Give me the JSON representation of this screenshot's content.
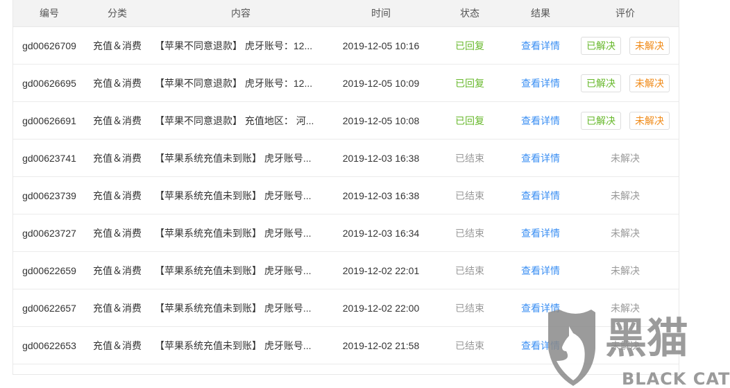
{
  "headers": [
    "编号",
    "分类",
    "内容",
    "时间",
    "状态",
    "结果",
    "评价"
  ],
  "rows": [
    {
      "id": "gd00626709",
      "cat": "充值＆消费",
      "content": "【苹果不同意退款】 虎牙账号：12...",
      "time": "2019-12-05 10:16",
      "status": "已回复",
      "result": "查看详情",
      "rated": false
    },
    {
      "id": "gd00626695",
      "cat": "充值＆消费",
      "content": "【苹果不同意退款】 虎牙账号：12...",
      "time": "2019-12-05 10:09",
      "status": "已回复",
      "result": "查看详情",
      "rated": false
    },
    {
      "id": "gd00626691",
      "cat": "充值＆消费",
      "content": "【苹果不同意退款】 充值地区： 河...",
      "time": "2019-12-05 10:08",
      "status": "已回复",
      "result": "查看详情",
      "rated": false
    },
    {
      "id": "gd00623741",
      "cat": "充值＆消费",
      "content": "【苹果系统充值未到账】 虎牙账号...",
      "time": "2019-12-03 16:38",
      "status": "已结束",
      "result": "查看详情",
      "rated": true,
      "rating": "未解决"
    },
    {
      "id": "gd00623739",
      "cat": "充值＆消费",
      "content": "【苹果系统充值未到账】 虎牙账号...",
      "time": "2019-12-03 16:38",
      "status": "已结束",
      "result": "查看详情",
      "rated": true,
      "rating": "未解决"
    },
    {
      "id": "gd00623727",
      "cat": "充值＆消费",
      "content": "【苹果系统充值未到账】 虎牙账号...",
      "time": "2019-12-03 16:34",
      "status": "已结束",
      "result": "查看详情",
      "rated": true,
      "rating": "未解决"
    },
    {
      "id": "gd00622659",
      "cat": "充值＆消费",
      "content": "【苹果系统充值未到账】 虎牙账号...",
      "time": "2019-12-02 22:01",
      "status": "已结束",
      "result": "查看详情",
      "rated": true,
      "rating": "未解决"
    },
    {
      "id": "gd00622657",
      "cat": "充值＆消费",
      "content": "【苹果系统充值未到账】 虎牙账号...",
      "time": "2019-12-02 22:00",
      "status": "已结束",
      "result": "查看详情",
      "rated": true,
      "rating": "未解决"
    },
    {
      "id": "gd00622653",
      "cat": "充值＆消费",
      "content": "【苹果系统充值未到账】 虎牙账号...",
      "time": "2019-12-02 21:58",
      "status": "已结束",
      "result": "查看详情",
      "rated": true,
      "rating": "未解决"
    }
  ],
  "buttons": {
    "resolved": "已解决",
    "unresolved": "未解决"
  },
  "watermark": {
    "cn": "黑猫",
    "en": "BLACK CAT"
  }
}
